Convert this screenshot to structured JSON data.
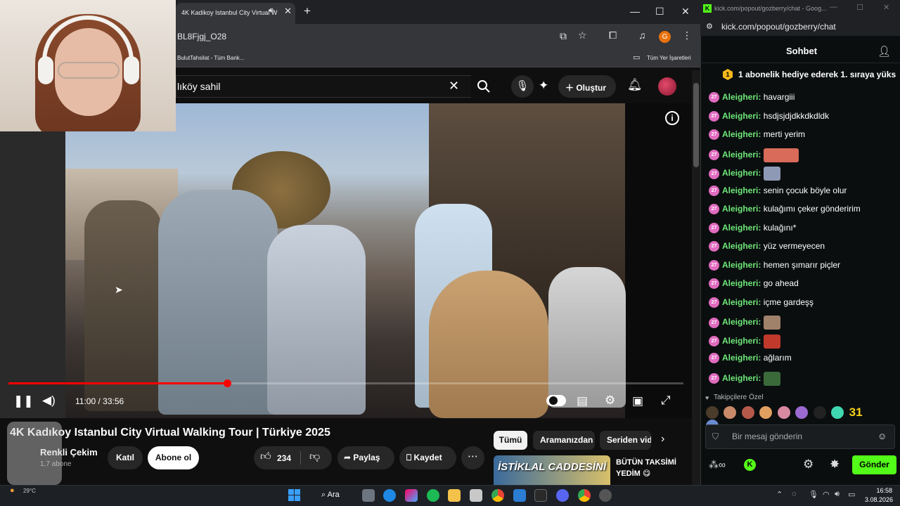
{
  "browser": {
    "tab_title": "4K Kadikoy Istanbul City Virtual W",
    "url_fragment": "BL8Fjgj_O28",
    "profile_letter": "G",
    "bookmark_1": "BulutTahsilat - Tüm Bank...",
    "bookmark_all": "Tüm Yer İşaretleri"
  },
  "youtube": {
    "search_value": "lıköy sahil",
    "create_label": "Oluştur",
    "player": {
      "current_time": "11:00",
      "duration": "33:56",
      "time_display": "11:00 / 33:56",
      "progress_fraction": 0.324
    },
    "video_title": "4K Kadıkoy Istanbul City Virtual Walking Tour | Türkiye 2025",
    "channel_name": "Renkli Çekim",
    "channel_subs": "1,7 abone",
    "join_label": "Katıl",
    "subscribe_label": "Abone ol",
    "like_count": "234",
    "share_label": "Paylaş",
    "save_label": "Kaydet",
    "chips": [
      "Tümü",
      "Aramanızdan",
      "Seriden vide"
    ],
    "rec_thumb_text": "İSTİKLAL CADDESİNİ",
    "rec_title": "BÜTÜN TAKSİMİ YEDİM 😋"
  },
  "chat": {
    "window_title": "kick.com/popout/gozberry/chat - Goog...",
    "url": "kick.com/popout/gozberry/chat",
    "header_title": "Sohbet",
    "pinned": "1 abonelik hediye ederek 1. sıraya yüks",
    "badge_text": "27",
    "messages": [
      {
        "user": "Aleigheri:",
        "text": "havargiii"
      },
      {
        "user": "Aleigheri:",
        "text": "hsdjsjdjdkkdkdldk"
      },
      {
        "user": "Aleigheri:",
        "text": "merti yerim"
      },
      {
        "user": "Aleigheri:",
        "text": ""
      },
      {
        "user": "Aleigheri:",
        "text": ""
      },
      {
        "user": "Aleigheri:",
        "text": "senin çocuk böyle olur"
      },
      {
        "user": "Aleigheri:",
        "text": "kulağımı çeker gönderirim"
      },
      {
        "user": "Aleigheri:",
        "text": "kulağını*"
      },
      {
        "user": "Aleigheri:",
        "text": "yüz vermeyecen"
      },
      {
        "user": "Aleigheri:",
        "text": "hemen şımarır piçler"
      },
      {
        "user": "Aleigheri:",
        "text": "go ahead"
      },
      {
        "user": "Aleigheri:",
        "text": "içme gardeşş"
      },
      {
        "user": "Aleigheri:",
        "text": ""
      },
      {
        "user": "Aleigheri:",
        "text": ""
      },
      {
        "user": "Aleigheri:",
        "text": "ağlarım"
      },
      {
        "user": "Aleigheri:",
        "text": ""
      }
    ],
    "followers_label": "Takipçilere Özel",
    "emote_31": "31",
    "input_placeholder": "Bir mesaj gönderin",
    "send_label": "Gönder"
  },
  "taskbar": {
    "search_label": "Ara",
    "weather": "29°C",
    "time": "16:58",
    "date": "3.08.2026"
  },
  "colors": {
    "kick_green": "#53fc18",
    "yt_red": "#ff0000",
    "chat_user": "#6ee87a",
    "badge_pink": "#e06bbf"
  }
}
